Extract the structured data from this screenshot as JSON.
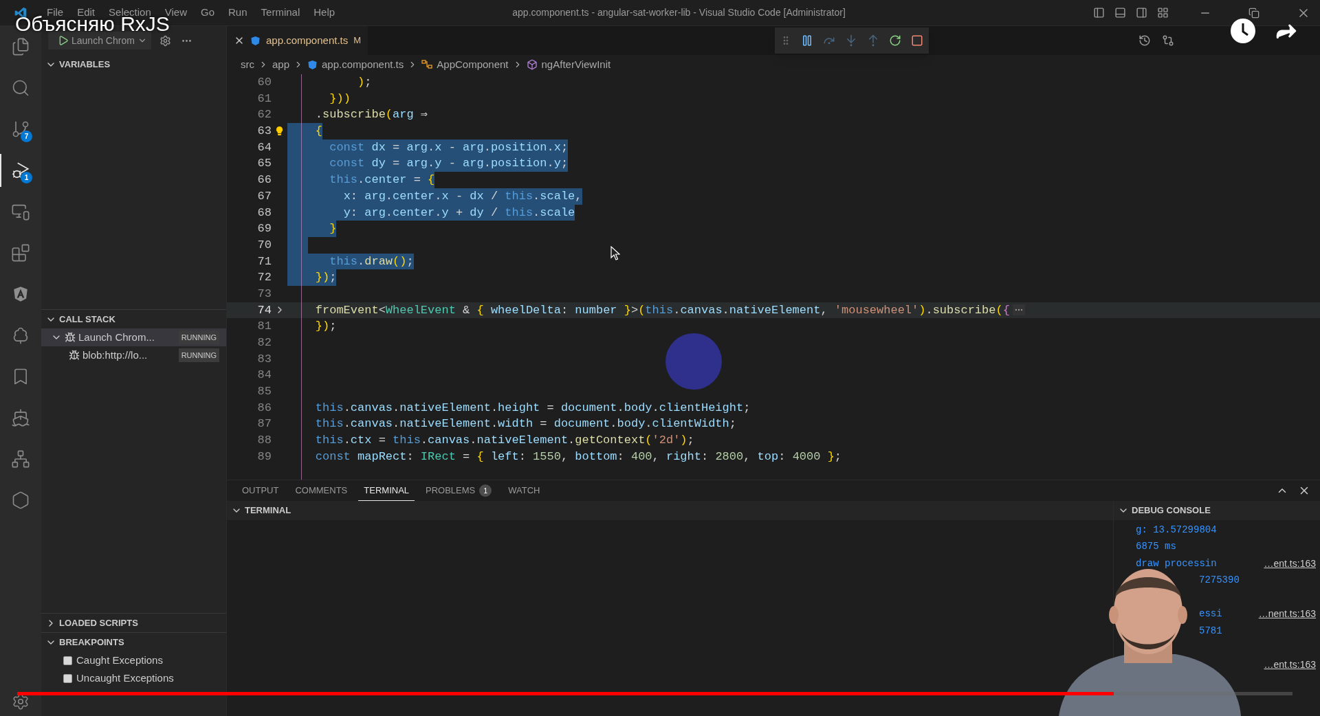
{
  "video": {
    "title": "Объясняю RxJS",
    "progress": {
      "level": 0.86
    }
  },
  "title_bar": {
    "menu": [
      "File",
      "Edit",
      "Selection",
      "View",
      "Go",
      "Run",
      "Terminal",
      "Help"
    ],
    "title": "app.component.ts - angular-sat-worker-lib - Visual Studio Code [Administrator]"
  },
  "activity_bar": [
    {
      "selected": false
    },
    {
      "selected": false
    },
    {
      "selected": false,
      "badge": "7"
    },
    {
      "selected": true,
      "badge": "1"
    },
    {
      "selected": false
    },
    {
      "selected": false
    },
    {
      "selected": false
    },
    {
      "selected": false
    },
    {
      "selected": false
    },
    {
      "selected": false
    },
    {
      "selected": false
    },
    {
      "selected": false
    }
  ],
  "sidebar": {
    "launch_config": "Launch Chrom",
    "variables": {
      "title": "VARIABLES",
      "expanded": true
    },
    "call_stack": {
      "title": "CALL STACK",
      "expanded": true,
      "items": [
        {
          "label": "Launch Chrom...",
          "status": "RUNNING",
          "expanded": true,
          "selected": true,
          "children": [
            {
              "label": "blob:http://lo...",
              "status": "RUNNING",
              "selected": false
            }
          ]
        }
      ]
    },
    "loaded_scripts": {
      "title": "LOADED SCRIPTS",
      "expanded": false
    },
    "breakpoints": {
      "title": "BREAKPOINTS",
      "expanded": true,
      "items": [
        {
          "label": "Caught Exceptions",
          "checked": false
        },
        {
          "label": "Uncaught Exceptions",
          "checked": false
        }
      ]
    }
  },
  "editor": {
    "tab": {
      "label": "app.component.ts",
      "status": "M"
    },
    "breadcrumbs": [
      {
        "label": "src",
        "kind": "folder"
      },
      {
        "label": "app",
        "kind": "folder"
      },
      {
        "label": "app.component.ts",
        "kind": "file"
      },
      {
        "label": "AppComponent",
        "kind": "class"
      },
      {
        "label": "ngAfterViewInit",
        "kind": "method"
      }
    ],
    "debug_toolbar": [
      {
        "disabled": false
      },
      {
        "disabled": true
      },
      {
        "disabled": true
      },
      {
        "disabled": true
      },
      {
        "disabled": false
      },
      {
        "disabled": false
      }
    ],
    "lines": [
      {
        "number": "60",
        "text": "          );",
        "selected": false,
        "current": false,
        "folded": false,
        "lightbulb": false
      },
      {
        "number": "61",
        "text": "      }))",
        "selected": false,
        "current": false,
        "folded": false,
        "lightbulb": false
      },
      {
        "number": "62",
        "text": "    .subscribe(arg ⇒",
        "selected": false,
        "current": false,
        "folded": false,
        "lightbulb": false
      },
      {
        "number": "63",
        "text": "    {",
        "selected": true,
        "current": false,
        "folded": false,
        "lightbulb": true
      },
      {
        "number": "64",
        "text": "      const dx = arg.x - arg.position.x;",
        "selected": true,
        "current": false,
        "folded": false,
        "lightbulb": false
      },
      {
        "number": "65",
        "text": "      const dy = arg.y - arg.position.y;",
        "selected": true,
        "current": false,
        "folded": false,
        "lightbulb": false
      },
      {
        "number": "66",
        "text": "      this.center = {",
        "selected": true,
        "current": false,
        "folded": false,
        "lightbulb": false
      },
      {
        "number": "67",
        "text": "        x: arg.center.x - dx / this.scale,",
        "selected": true,
        "current": false,
        "folded": false,
        "lightbulb": false
      },
      {
        "number": "68",
        "text": "        y: arg.center.y + dy / this.scale",
        "selected": true,
        "current": false,
        "folded": false,
        "lightbulb": false
      },
      {
        "number": "69",
        "text": "      }",
        "selected": true,
        "current": false,
        "folded": false,
        "lightbulb": false
      },
      {
        "number": "70",
        "selected": true,
        "current": false,
        "folded": false,
        "lightbulb": false
      },
      {
        "number": "71",
        "text": "      this.draw();",
        "selected": true,
        "current": false,
        "folded": false,
        "lightbulb": false
      },
      {
        "number": "72",
        "text": "    });",
        "selected": true,
        "current": false,
        "folded": false,
        "lightbulb": false
      },
      {
        "number": "73",
        "selected": false,
        "current": false,
        "folded": false,
        "lightbulb": false
      },
      {
        "number": "74",
        "text": "    fromEvent<WheelEvent & { wheelDelta: number }>(this.canvas.nativeElement, 'mousewheel').subscribe({",
        "selected": false,
        "current": true,
        "folded": true,
        "lightbulb": false
      },
      {
        "number": "81",
        "text": "    });",
        "selected": false,
        "current": false,
        "folded": false,
        "lightbulb": false
      },
      {
        "number": "82",
        "selected": false,
        "current": false,
        "folded": false,
        "lightbulb": false
      },
      {
        "number": "83",
        "selected": false,
        "current": false,
        "folded": false,
        "lightbulb": false
      },
      {
        "number": "84",
        "selected": false,
        "current": false,
        "folded": false,
        "lightbulb": false
      },
      {
        "number": "85",
        "selected": false,
        "current": false,
        "folded": false,
        "lightbulb": false
      },
      {
        "number": "86",
        "text": "    this.canvas.nativeElement.height = document.body.clientHeight;",
        "selected": false,
        "current": false,
        "folded": false,
        "lightbulb": false
      },
      {
        "number": "87",
        "text": "    this.canvas.nativeElement.width = document.body.clientWidth;",
        "selected": false,
        "current": false,
        "folded": false,
        "lightbulb": false
      },
      {
        "number": "88",
        "text": "    this.ctx = this.canvas.nativeElement.getContext('2d');",
        "selected": false,
        "current": false,
        "folded": false,
        "lightbulb": false
      },
      {
        "number": "89",
        "text": "    const mapRect: IRect = { left: 1550, bottom: 400, right: 2800, top: 4000 };",
        "selected": false,
        "current": false,
        "folded": false,
        "lightbulb": false
      }
    ]
  },
  "panel": {
    "tabs": [
      {
        "label": "OUTPUT",
        "selected": false
      },
      {
        "label": "COMMENTS",
        "selected": false
      },
      {
        "label": "TERMINAL",
        "selected": true
      },
      {
        "label": "PROBLEMS",
        "selected": false,
        "badge": "1"
      },
      {
        "label": "WATCH",
        "selected": false
      }
    ],
    "terminal": {
      "title": "TERMINAL",
      "expanded": true
    },
    "debug_console": {
      "title": "DEBUG CONSOLE",
      "expanded": true,
      "lines": [
        {
          "kind": "visible",
          "text": "g: 13.57299804"
        },
        {
          "kind": "visible",
          "text": "6875 ms"
        },
        {
          "kind": "visible",
          "text": "draw processin",
          "source": "…ent.ts:163"
        },
        {
          "kind": "clipped",
          "text": "7275390"
        },
        {
          "kind": "spacer"
        },
        {
          "kind": "clipped",
          "text": "essi",
          "source": "…nent.ts:163"
        },
        {
          "kind": "clipped",
          "text": "5781"
        },
        {
          "kind": "spacer"
        },
        {
          "kind": "clipped",
          "source": "…ent.ts:163"
        }
      ]
    }
  }
}
